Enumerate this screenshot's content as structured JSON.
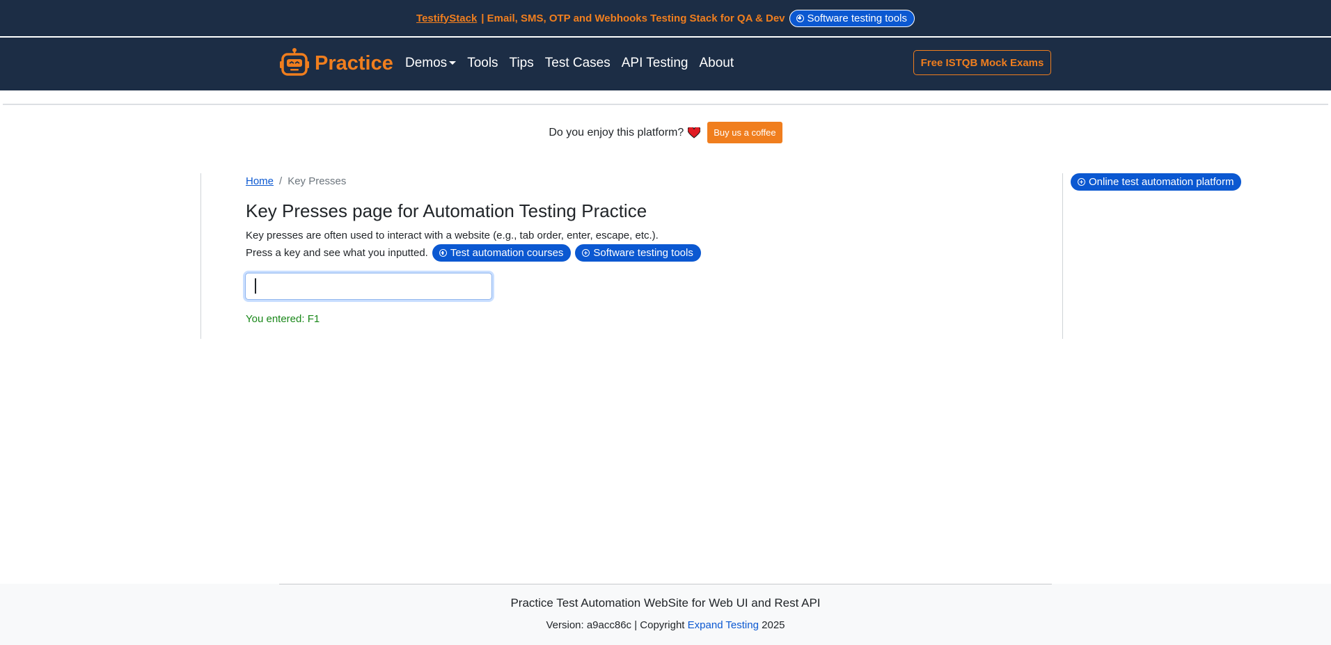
{
  "banner": {
    "brand": "TestifyStack",
    "text": "| Email, SMS, OTP and Webhooks Testing Stack for QA & Dev",
    "pill_label": "Software testing tools"
  },
  "navbar": {
    "logo_text": "Practice",
    "links": [
      "Demos",
      "Tools",
      "Tips",
      "Test Cases",
      "API Testing",
      "About"
    ],
    "cta_label": "Free ISTQB Mock Exams"
  },
  "promo": {
    "question": "Do you enjoy this platform?",
    "coffee_label": "Buy us a coffee"
  },
  "breadcrumb": {
    "home": "Home",
    "separator": "/",
    "current": "Key Presses"
  },
  "main": {
    "title": "Key Presses page for Automation Testing Practice",
    "desc_line1": "Key presses are often used to interact with a website (e.g., tab order, enter, escape, etc.).",
    "desc_line2": "Press a key and see what you inputted.",
    "pill_courses": "Test automation courses",
    "pill_tools": "Software testing tools",
    "input_value": "",
    "result_text": "You entered: F1"
  },
  "sidebar": {
    "pill_label": "Online test automation platform"
  },
  "footer": {
    "title": "Practice Test Automation WebSite for Web UI and Rest API",
    "version_prefix": "Version: a9acc86c | Copyright",
    "company": "Expand Testing",
    "year": "2025"
  },
  "colors": {
    "navy": "#1c2d45",
    "orange": "#f07e1e",
    "blue": "#0b58d1",
    "green": "#198719"
  }
}
